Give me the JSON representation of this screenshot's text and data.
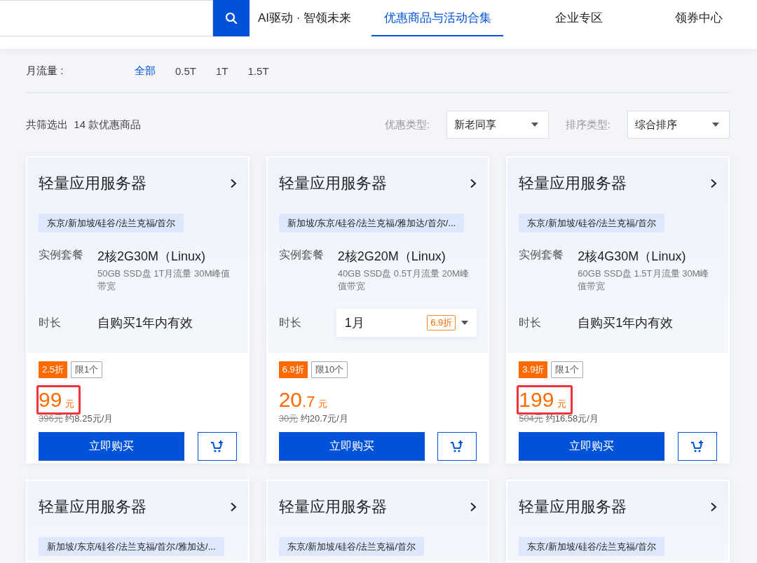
{
  "nav": {
    "items": [
      {
        "label": "AI驱动 · 智领未来",
        "selected": false
      },
      {
        "label": "优惠商品与活动合集",
        "selected": true
      },
      {
        "label": "企业专区",
        "selected": false
      },
      {
        "label": "领券中心",
        "selected": false
      }
    ]
  },
  "traffic_filter": {
    "label": "月流量 :",
    "options": [
      {
        "label": "全部",
        "selected": true
      },
      {
        "label": "0.5T",
        "selected": false
      },
      {
        "label": "1T",
        "selected": false
      },
      {
        "label": "1.5T",
        "selected": false
      }
    ]
  },
  "results": {
    "summary": "共筛选出  14 款优惠商品",
    "selects": [
      {
        "label": "优惠类型:",
        "value": "新老同享"
      },
      {
        "label": "排序类型:",
        "value": "综合排序"
      }
    ]
  },
  "cards": [
    {
      "title": "轻量应用服务器",
      "regions": "东京/新加坡/硅谷/法兰克福/首尔",
      "spec_label": "实例套餐",
      "spec": "2核2G30M（Linux)",
      "spec_detail": "50GB SSD盘 1T月流量 30M峰值带宽",
      "duration_label": "时长",
      "duration": {
        "kind": "text",
        "value": "自购买1年内有效"
      },
      "discount": "2.5折",
      "limit": "限1个",
      "price_whole": "99",
      "unit": "元",
      "highlighted": true,
      "original_price": "396元",
      "monthly": "约8.25元/月",
      "buy": "立即购买"
    },
    {
      "title": "轻量应用服务器",
      "regions": "新加坡/东京/硅谷/法兰克福/雅加达/首尔/...",
      "spec_label": "实例套餐",
      "spec": "2核2G20M（Linux)",
      "spec_detail": "40GB SSD盘 0.5T月流量 20M峰值带宽",
      "duration_label": "时长",
      "duration": {
        "kind": "select",
        "value": "1月",
        "badge": "6.9折"
      },
      "discount": "6.9折",
      "limit": "限10个",
      "price_whole": "20",
      "price_fraction": ".7",
      "unit": "元",
      "highlighted": false,
      "original_price": "30元",
      "monthly": "约20.7元/月",
      "buy": "立即购买"
    },
    {
      "title": "轻量应用服务器",
      "regions": "东京/新加坡/硅谷/法兰克福/首尔",
      "spec_label": "实例套餐",
      "spec": "2核4G30M（Linux)",
      "spec_detail": "60GB SSD盘 1.5T月流量 30M峰值带宽",
      "duration_label": "时长",
      "duration": {
        "kind": "text",
        "value": "自购买1年内有效"
      },
      "discount": "3.9折",
      "limit": "限1个",
      "price_whole": "199",
      "unit": "元",
      "highlighted": true,
      "original_price": "504元",
      "monthly": "约16.58元/月",
      "buy": "立即购买"
    }
  ],
  "more_cards": [
    {
      "title": "轻量应用服务器",
      "regions": "新加坡/东京/硅谷/法兰克福/首尔/雅加达/..."
    },
    {
      "title": "轻量应用服务器",
      "regions": "东京/新加坡/硅谷/法兰克福/首尔"
    },
    {
      "title": "轻量应用服务器",
      "regions": "东京/新加坡/硅谷/法兰克福/首尔"
    }
  ]
}
